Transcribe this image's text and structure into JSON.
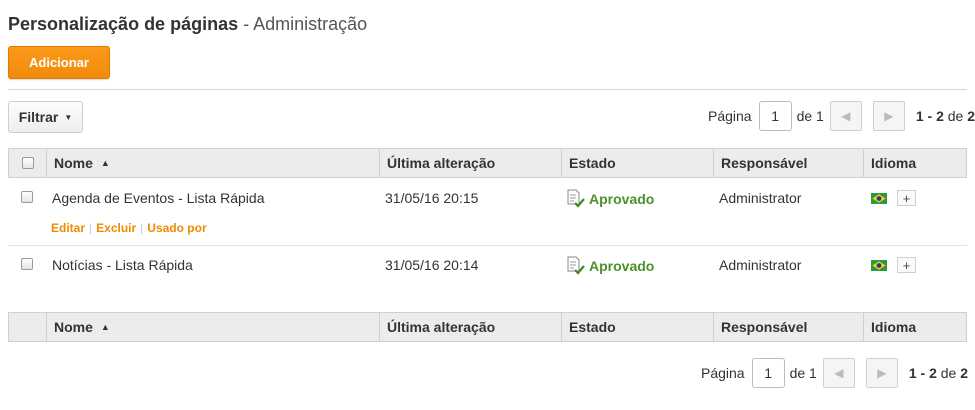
{
  "header": {
    "title_main": "Personalização de páginas",
    "title_sub": " - Administração"
  },
  "toolbar": {
    "add_label": "Adicionar",
    "filter_label": "Filtrar"
  },
  "pager": {
    "page_label": "Página",
    "page_value": "1",
    "of_label": "de 1",
    "range": "1 - 2",
    "range_of": " de ",
    "total": "2"
  },
  "table": {
    "columns": [
      "Nome",
      "Última alteração",
      "Estado",
      "Responsável",
      "Idioma"
    ],
    "rows": [
      {
        "name": "Agenda de Eventos - Lista Rápida",
        "modified": "31/05/16 20:15",
        "status": "Aprovado",
        "owner": "Administrator",
        "actions": [
          "Editar",
          "Excluir",
          "Usado por"
        ]
      },
      {
        "name": "Notícias - Lista Rápida",
        "modified": "31/05/16 20:14",
        "status": "Aprovado",
        "owner": "Administrator"
      }
    ]
  },
  "colors": {
    "accent": "#f7941d",
    "link": "#f08a00",
    "approved": "#4d8f2a"
  },
  "icons": {
    "sort": "sort-ascending-icon",
    "status": "approved-document-icon",
    "flag": "brazil-flag-icon",
    "add_language": "plus-icon"
  }
}
